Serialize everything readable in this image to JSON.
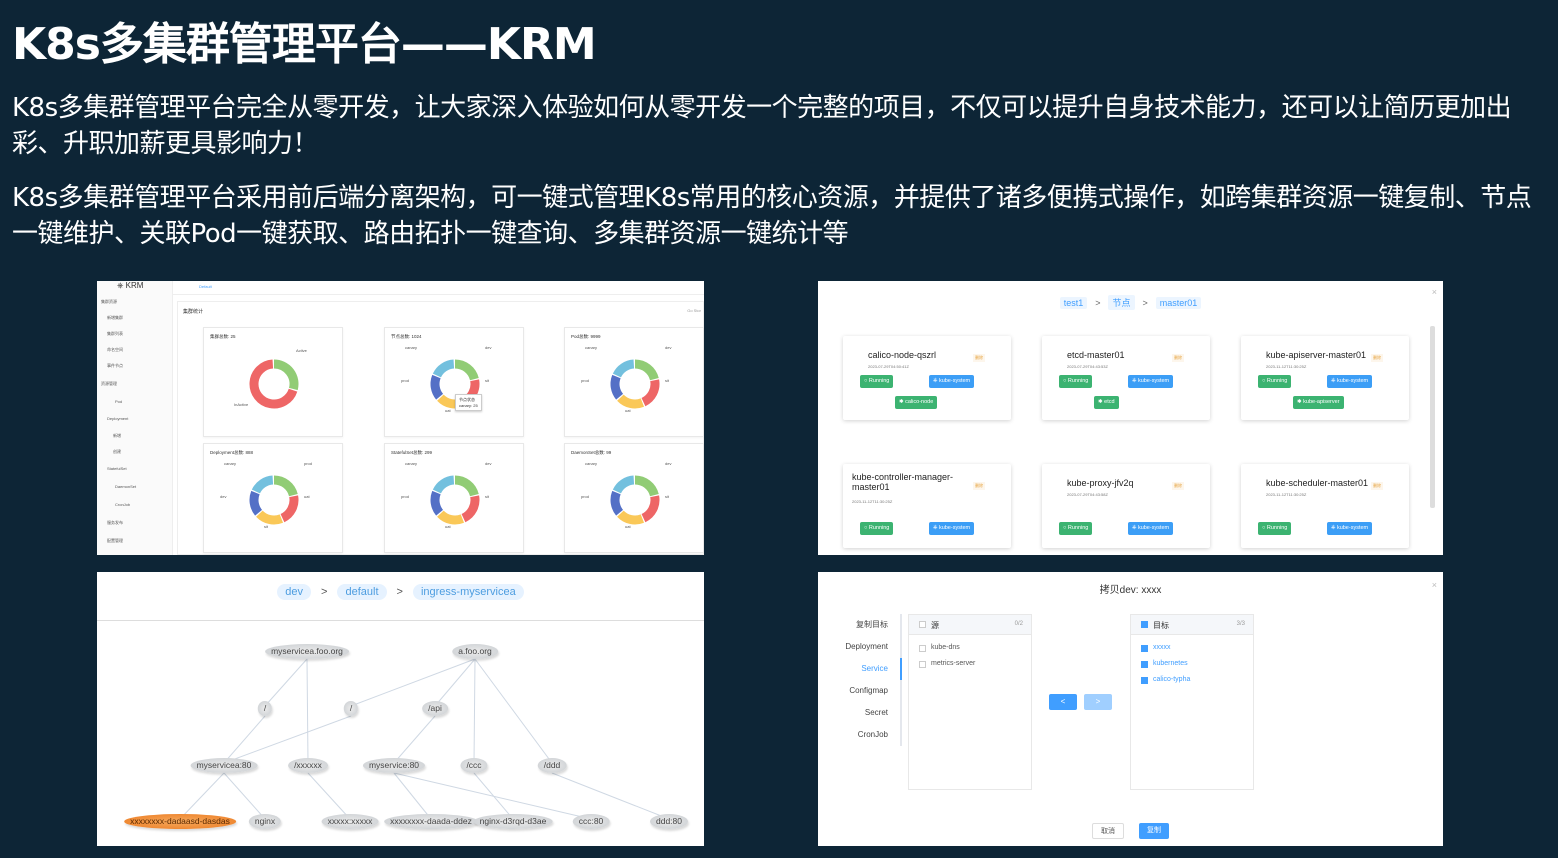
{
  "title": "K8s多集群管理平台——KRM",
  "paragraphs": [
    "K8s多集群管理平台完全从零开发，让大家深入体验如何从零开发一个完整的项目，不仅可以提升自身技术能力，还可以让简历更加出彩、升职加薪更具影响力！",
    "K8s多集群管理平台采用前后端分离架构，可一键式管理K8s常用的核心资源，并提供了诸多便携式操作，如跨集群资源一键复制、节点一键维护、关联Pod一键获取、路由拓扑一键查询、多集群资源一键统计等"
  ],
  "dashboard": {
    "logo": "KRM",
    "tab": "Default",
    "header": "集群统计",
    "header_right": "Go Stor",
    "sidebar": [
      "集群资源",
      "新增集群",
      "集群列表",
      "命名空间",
      "事件节点",
      "资源管理",
      "Pod",
      "Deployment",
      "新增",
      "创建",
      "StatefulSet",
      "DaemonSet",
      "CronJob",
      "服务发布",
      "配置管理"
    ],
    "cards": [
      {
        "title": "集群总数: 25",
        "labels": [
          "Active",
          "InActive"
        ]
      },
      {
        "title": "节点总数: 1024",
        "labels": [
          "canary",
          "dev",
          "prod",
          "sit",
          "uat"
        ],
        "tooltip": [
          "节点状态",
          "canary: 25"
        ]
      },
      {
        "title": "Pod总数: 9999",
        "labels": [
          "canary",
          "dev",
          "prod",
          "sit",
          "uat"
        ]
      },
      {
        "title": "Deployment总数: 888",
        "labels": [
          "canary",
          "prod",
          "dev",
          "uat",
          "sit"
        ]
      },
      {
        "title": "StatefulSet总数: 299",
        "labels": [
          "canary",
          "dev",
          "prod",
          "sit",
          "uat"
        ]
      },
      {
        "title": "DaemonSet总数: 99",
        "labels": [
          "canary",
          "dev",
          "prod",
          "sit",
          "uat"
        ]
      }
    ],
    "colors": [
      "#91cc75",
      "#ee6666",
      "#fac858",
      "#5470c6",
      "#73c0de"
    ]
  },
  "pods": {
    "crumbs": [
      "test1",
      "节点",
      "master01"
    ],
    "sep": ">",
    "close": "×",
    "items": [
      {
        "name": "calico-node-qszrl",
        "date": "2023-07-29T04:50:41Z",
        "badge": "删除",
        "tags": [
          "Running",
          "kube-system",
          "calico-node"
        ]
      },
      {
        "name": "etcd-master01",
        "date": "2023-07-29T04:43:53Z",
        "badge": "删除",
        "tags": [
          "Running",
          "kube-system",
          "etcd"
        ]
      },
      {
        "name": "kube-apiserver-master01",
        "date": "2023-11-12T11:30:25Z",
        "badge": "删除",
        "tags": [
          "Running",
          "kube-system",
          "kube-apiserver"
        ]
      },
      {
        "name": "kube-controller-manager-master01",
        "date": "2023-11-12T11:30:25Z",
        "badge": "删除",
        "tags": [
          "Running",
          "kube-system"
        ]
      },
      {
        "name": "kube-proxy-jfv2q",
        "date": "2023-07-29T04:43:58Z",
        "badge": "删除",
        "tags": [
          "Running",
          "kube-system"
        ]
      },
      {
        "name": "kube-scheduler-master01",
        "date": "2023-11-12T11:30:25Z",
        "badge": "删除",
        "tags": [
          "Running",
          "kube-system"
        ]
      }
    ]
  },
  "topology": {
    "crumbs": [
      "dev",
      "default",
      "ingress-myservicea"
    ],
    "sep": ">",
    "nodes": [
      "myservicea.foo.org",
      "a.foo.org",
      "/",
      "/",
      "/api",
      "myservicea:80",
      "/xxxxxx",
      "myservice:80",
      "/ccc",
      "/ddd",
      "xxxxxxxx-dadaasd-dasdas",
      "nginx",
      "xxxxx:xxxxx",
      "xxxxxxxx-daada-ddez",
      "nginx-d3rqd-d3ae",
      "ccc:80",
      "ddd:80"
    ]
  },
  "copy": {
    "title": "拷贝dev: xxxx",
    "close": "×",
    "menu": [
      "复制目标",
      "Deployment",
      "Service",
      "Configmap",
      "Secret",
      "CronJob"
    ],
    "source": {
      "title": "源",
      "count": "0/2",
      "items": [
        "kube-dns",
        "metrics-server"
      ]
    },
    "target": {
      "title": "目标",
      "count": "3/3",
      "items": [
        "xxxxx",
        "kubernetes",
        "calico-typha"
      ]
    },
    "left_arrow": "<",
    "right_arrow": ">",
    "cancel": "取消",
    "confirm": "复制"
  }
}
